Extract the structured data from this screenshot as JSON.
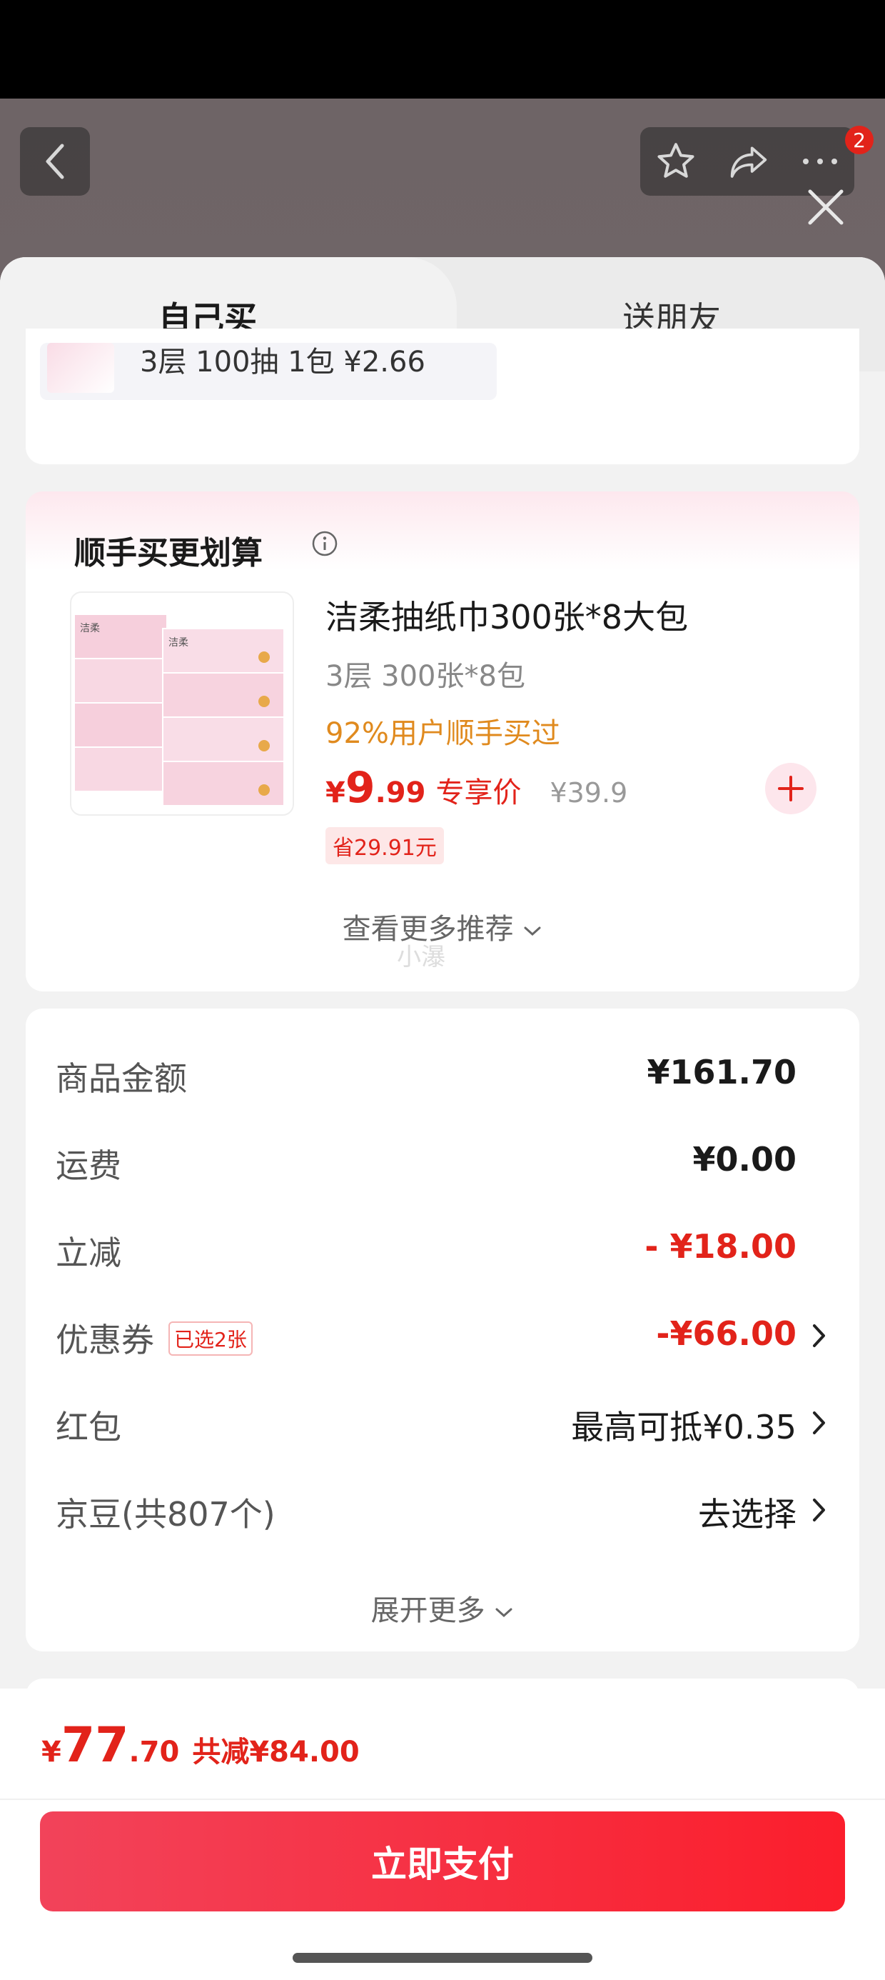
{
  "header": {
    "cart_badge": "2"
  },
  "tabs": {
    "self": "自己买",
    "gift": "送朋友"
  },
  "prev_item": {
    "text": "3层 100抽 1包 ¥2.66"
  },
  "recommend": {
    "title": "顺手买更划算",
    "product": {
      "name": "洁柔抽纸巾300张*8大包",
      "spec": "3层 300张*8包",
      "social": "92%用户顺手买过",
      "currency": "¥",
      "price_int": "9",
      "price_dec": ".99",
      "price_tag": "专享价",
      "orig_price": "¥39.9",
      "save": "省29.91元",
      "pack_label": "洁柔"
    },
    "more": "查看更多推荐",
    "watermark": "小瀑"
  },
  "summary": {
    "rows": [
      {
        "label": "商品金额",
        "value": "¥161.70"
      },
      {
        "label": "运费",
        "value": "¥0.00"
      },
      {
        "label": "立减",
        "value": "- ¥18.00"
      },
      {
        "label": "优惠券",
        "tag": "已选2张",
        "value": "-¥66.00"
      },
      {
        "label": "红包",
        "value": "最高可抵¥0.35"
      },
      {
        "label": "京豆(共807个)",
        "value": "去选择"
      }
    ],
    "expand": "展开更多"
  },
  "footer": {
    "currency": "¥",
    "total_int": "77",
    "total_dec": ".70",
    "saved": "共减¥84.00",
    "pay_label": "立即支付"
  },
  "colors": {
    "accent": "#e2231a",
    "button": "#fb1e2c"
  }
}
